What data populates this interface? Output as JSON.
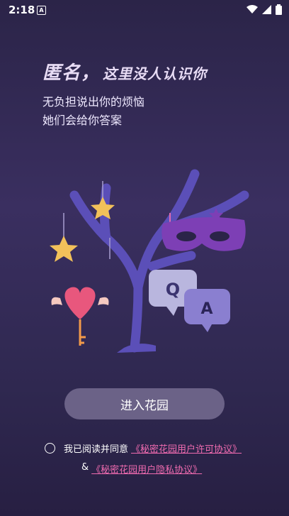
{
  "status_bar": {
    "time": "2:18",
    "notif": "A"
  },
  "header": {
    "title_main": "匿名，",
    "title_sub": "这里没人认识你",
    "line1": "无负担说出你的烦恼",
    "line2": "她们会给你答案"
  },
  "illustration": {
    "q_label": "Q",
    "a_label": "A"
  },
  "actions": {
    "enter_label": "进入花园"
  },
  "agreement": {
    "prefix": "我已阅读并同意",
    "license_link": "《秘密花园用户许可协议》",
    "amp": "&",
    "privacy_link": "《秘密花园用户隐私协议》"
  },
  "colors": {
    "accent": "#f06bb0",
    "button": "#6b6287",
    "tree": "#5b4fb8"
  }
}
